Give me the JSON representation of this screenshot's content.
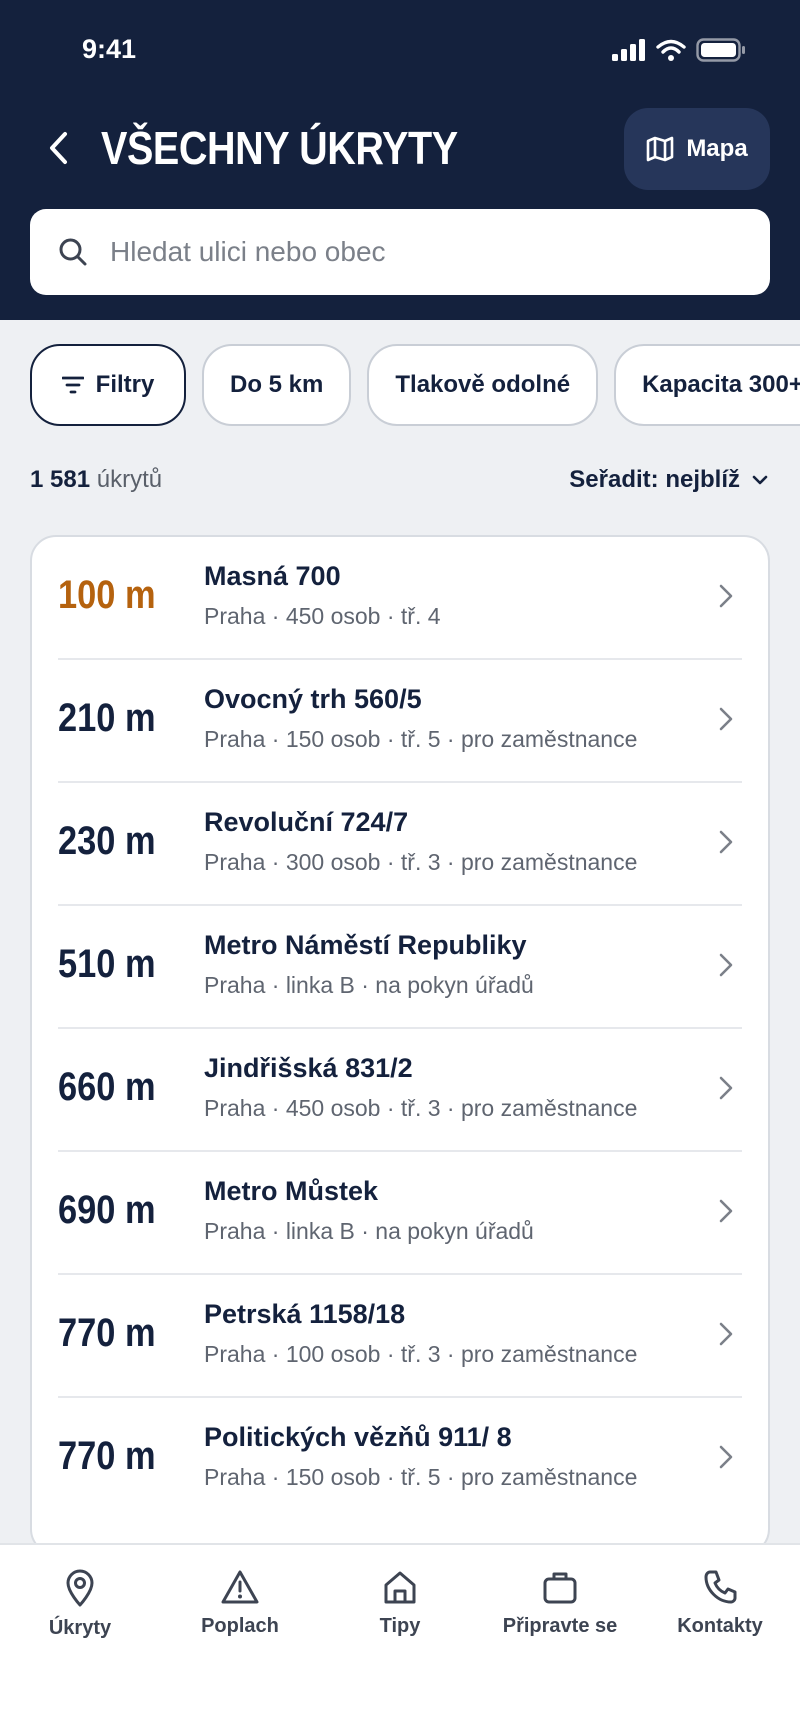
{
  "status_bar": {
    "time": "9:41"
  },
  "header": {
    "title": "VŠECHNY ÚKRYTY",
    "map_button_label": "Mapa"
  },
  "search": {
    "placeholder": "Hledat ulici nebo obec"
  },
  "filters": {
    "filter_button_label": "Filtry",
    "chips": [
      "Do 5 km",
      "Tlakově odolné",
      "Kapacita 300+"
    ]
  },
  "results": {
    "count": "1 581",
    "count_unit": "úkrytů",
    "sort_label": "Seřadit: nejblíž"
  },
  "shelters": [
    {
      "distance": "100 m",
      "name": "Masná 700",
      "detail": "Praha · 450 osob · tř. 4"
    },
    {
      "distance": "210 m",
      "name": "Ovocný trh 560/5",
      "detail": "Praha · 150 osob · tř. 5 · pro zaměstnance"
    },
    {
      "distance": "230 m",
      "name": "Revoluční 724/7",
      "detail": "Praha · 300 osob · tř. 3 · pro zaměstnance"
    },
    {
      "distance": "510 m",
      "name": "Metro Náměstí Republiky",
      "detail": "Praha · linka B · na pokyn úřadů"
    },
    {
      "distance": "660 m",
      "name": "Jindřišská 831/2",
      "detail": "Praha · 450 osob · tř. 3 · pro zaměstnance"
    },
    {
      "distance": "690 m",
      "name": "Metro Můstek",
      "detail": "Praha · linka B · na pokyn úřadů"
    },
    {
      "distance": "770 m",
      "name": "Petrská 1158/18",
      "detail": "Praha · 100 osob · tř. 3 · pro zaměstnance"
    },
    {
      "distance": "770 m",
      "name": "Politických vězňů 911/ 8",
      "detail": "Praha · 150 osob · tř. 5 · pro zaměstnance"
    }
  ],
  "tabbar": {
    "items": [
      {
        "label": "Úkryty",
        "icon": "pin-icon"
      },
      {
        "label": "Poplach",
        "icon": "warning-icon"
      },
      {
        "label": "Tipy",
        "icon": "home-icon"
      },
      {
        "label": "Připravte se",
        "icon": "briefcase-icon"
      },
      {
        "label": "Kontakty",
        "icon": "phone-icon"
      }
    ]
  },
  "colors": {
    "header_bg": "#14213d",
    "nearest_accent": "#b5620e",
    "page_bg": "#eef0f3"
  }
}
